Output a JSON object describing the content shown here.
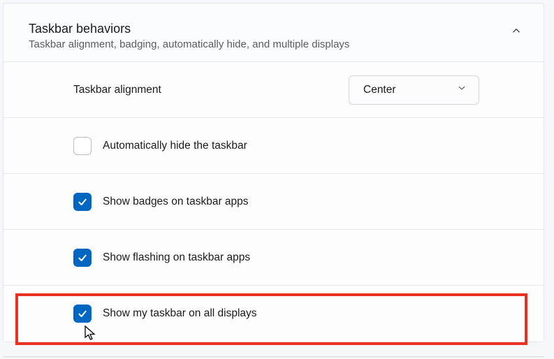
{
  "header": {
    "title": "Taskbar behaviors",
    "subtitle": "Taskbar alignment, badging, automatically hide, and multiple displays"
  },
  "alignment": {
    "label": "Taskbar alignment",
    "value": "Center"
  },
  "options": {
    "autohide": {
      "label": "Automatically hide the taskbar",
      "checked": false
    },
    "badges": {
      "label": "Show badges on taskbar apps",
      "checked": true
    },
    "flashing": {
      "label": "Show flashing on taskbar apps",
      "checked": true
    },
    "alldisplays": {
      "label": "Show my taskbar on all displays",
      "checked": true
    }
  }
}
